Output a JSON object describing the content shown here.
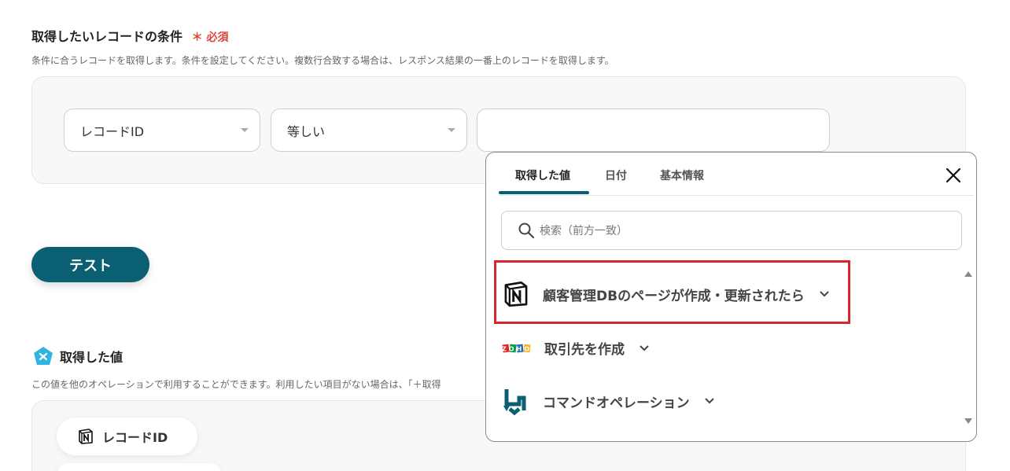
{
  "conditions": {
    "title": "取得したいレコードの条件",
    "required_mark": "＊",
    "required_label": "必須",
    "description": "条件に合うレコードを取得します。条件を設定してください。複数行合致する場合は、レスポンス結果の一番上のレコードを取得します。",
    "field_select": "レコードID",
    "operator_select": "等しい",
    "value_input": ""
  },
  "test_button": {
    "label": "テスト"
  },
  "acquired": {
    "title": "取得した値",
    "description": "この値を他のオペレーションで利用することができます。利用したい項目がない場合は、「＋取得",
    "chips": [
      {
        "label": "レコードID",
        "icon": "notion-icon"
      }
    ]
  },
  "popup": {
    "tabs": [
      {
        "label": "取得した値",
        "active": true
      },
      {
        "label": "日付",
        "active": false
      },
      {
        "label": "基本情報",
        "active": false
      }
    ],
    "search_placeholder": "検索（前方一致）",
    "items": [
      {
        "label": "顧客管理DBのページが作成・更新されたら",
        "icon": "notion-icon",
        "highlighted": true
      },
      {
        "label": "取引先を作成",
        "icon": "zoho-icon",
        "highlighted": false
      },
      {
        "label": "コマンドオペレーション",
        "icon": "command-operation-icon",
        "highlighted": false
      }
    ],
    "zoho_logo_text": "ZOHO"
  },
  "colors": {
    "accent": "#0b5f73",
    "required": "#e0453c",
    "highlight": "#d9262c"
  }
}
